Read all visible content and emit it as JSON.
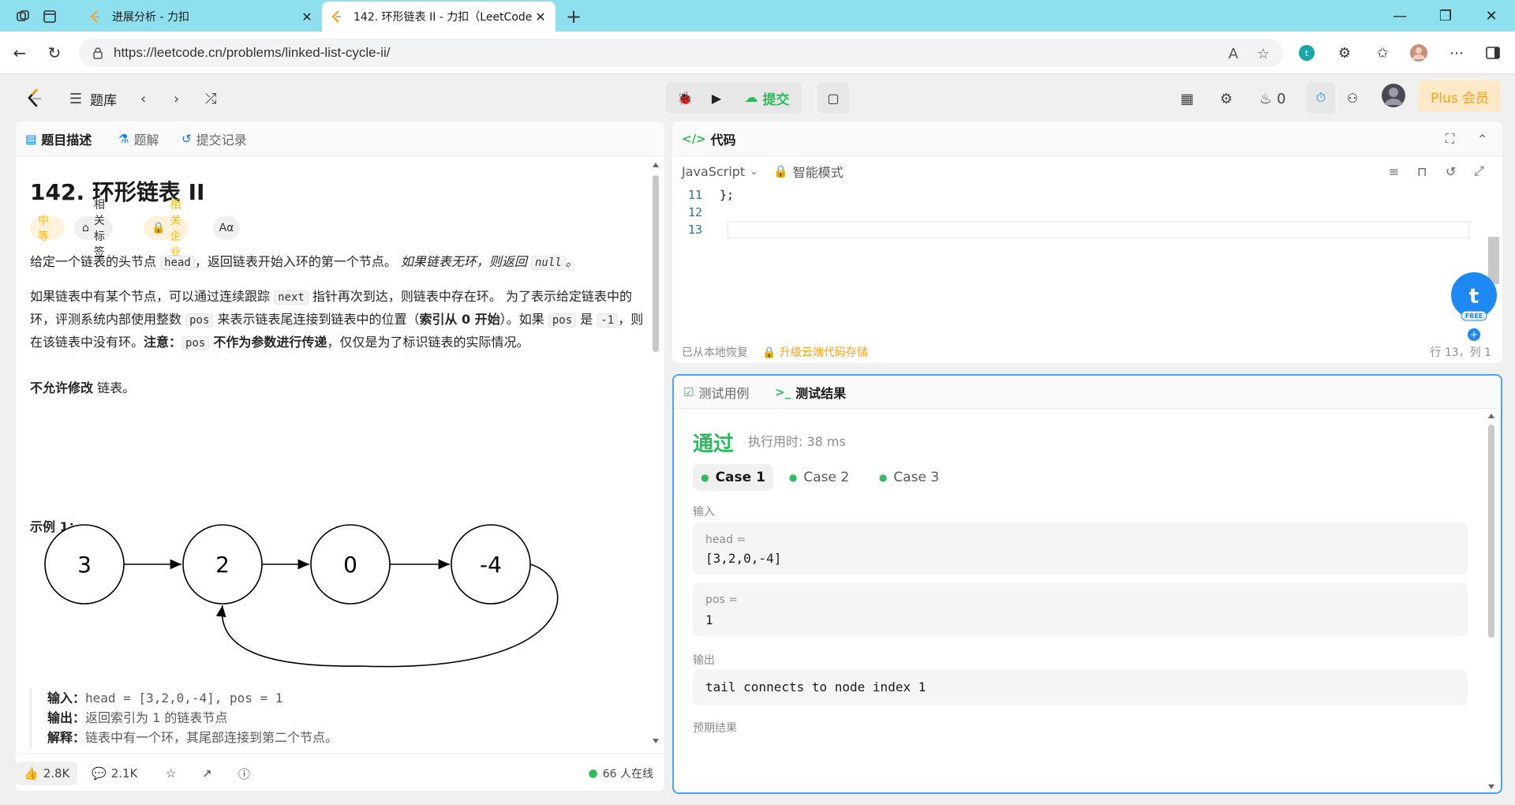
{
  "browser": {
    "tabs": [
      {
        "title": "进展分析 - 力扣",
        "active": false
      },
      {
        "title": "142. 环形链表 II - 力扣（LeetCode",
        "active": true
      }
    ],
    "url": "https://leetcode.cn/problems/linked-list-cycle-ii/"
  },
  "nav": {
    "problem_bank": "题库",
    "submit": "提交",
    "streak_count": "0",
    "plus": "Plus 会员"
  },
  "left": {
    "tabs": [
      "题目描述",
      "题解",
      "提交记录"
    ],
    "title": "142. 环形链表 II",
    "tags": {
      "difficulty": "中等",
      "related_tags": "相关标签",
      "companies": "相关企业",
      "font": "Aα"
    },
    "p1": {
      "a": "给定一个链表的头节点 ",
      "code1": "head",
      "b": "，返回链表开始入环的第一个节点。 ",
      "c": "如果链表无环，则返回 ",
      "code2": "null",
      "d": "。"
    },
    "p2": {
      "a": "如果链表中有某个节点，可以通过连续跟踪 ",
      "code1": "next",
      "b": " 指针再次到达，则链表中存在环。 为了表示给定链表中的环，评测系统内部使用整数 ",
      "code2": "pos",
      "c": " 来表示链表尾连接到链表中的位置（",
      "d": "索引从 0 开始",
      "e": "）。如果 ",
      "code3": "pos",
      "f": " 是 ",
      "code4": "-1",
      "g": "，则在该链表中没有环。",
      "h": "注意：",
      "code5": "pos",
      "i": "不作为参数进行传递",
      "j": "，仅仅是为了标识链表的实际情况。"
    },
    "p3": {
      "a": "不允许修改",
      "b": " 链表。"
    },
    "example_title": "示例 1：",
    "diagram_nodes": [
      "3",
      "2",
      "0",
      "-4"
    ],
    "example": {
      "input_label": "输入：",
      "input_value": "head = [3,2,0,-4], pos = 1",
      "output_label": "输出：",
      "output_value": "返回索引为 1 的链表节点",
      "explain_label": "解释：",
      "explain_value": "链表中有一个环，其尾部连接到第二个节点。"
    },
    "footer": {
      "likes": "2.8K",
      "comments": "2.1K",
      "online": "66 人在线"
    }
  },
  "code": {
    "title": "代码",
    "language": "JavaScript",
    "mode": "智能模式",
    "lines": [
      {
        "num": "11",
        "text": "};"
      },
      {
        "num": "12",
        "text": ""
      },
      {
        "num": "13",
        "text": ""
      }
    ],
    "restored": "已从本地恢复",
    "upgrade": "升级云端代码存储",
    "cursor": "行 13，列 1"
  },
  "test": {
    "tabs": [
      "测试用例",
      "测试结果"
    ],
    "status": "通过",
    "runtime": "执行用时: 38 ms",
    "cases": [
      "Case 1",
      "Case 2",
      "Case 3"
    ],
    "input_label": "输入",
    "vars": [
      {
        "name": "head =",
        "value": "[3,2,0,-4]"
      },
      {
        "name": "pos =",
        "value": "1"
      }
    ],
    "output_label": "输出",
    "output_value": "tail connects to node index 1",
    "expected_label": "预期结果"
  },
  "colors": {
    "accent_green": "#2cbb5d",
    "brand_orange": "#ffa116",
    "focus_blue": "#4aa3ff"
  }
}
